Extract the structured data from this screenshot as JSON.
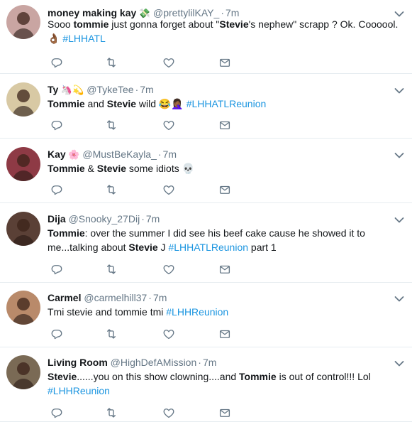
{
  "tweets": [
    {
      "name": "money making kay",
      "name_emoji": "💸",
      "handle": "@prettylilKAY_",
      "separator": "·",
      "time": "7m",
      "parts": [
        {
          "t": "Sooo "
        },
        {
          "t": "tommie",
          "b": true
        },
        {
          "t": " just gonna forget about \""
        },
        {
          "t": "Stevie",
          "b": true
        },
        {
          "t": "'s nephew\"  scrapp ? Ok. Coooool."
        }
      ],
      "line2": [
        {
          "t": "👌🏾 "
        },
        {
          "t": "#LHHATL",
          "tag": true
        }
      ],
      "avatar_color": "#c9a5a2"
    },
    {
      "name": "Ty",
      "name_emoji": "🦄💫",
      "handle": "@TykeTee",
      "separator": "·",
      "time": "7m",
      "parts": [
        {
          "t": "Tommie",
          "b": true
        },
        {
          "t": " and "
        },
        {
          "t": "Stevie",
          "b": true
        },
        {
          "t": " wild 😂🤦🏾‍♀️ "
        },
        {
          "t": "#LHHATLReunion",
          "tag": true
        }
      ],
      "line2": [],
      "avatar_color": "#d8c9a4"
    },
    {
      "name": "Kay",
      "name_emoji": "🌸",
      "handle": "@MustBeKayla_",
      "separator": "·",
      "time": "7m",
      "parts": [
        {
          "t": "Tommie",
          "b": true
        },
        {
          "t": " & "
        },
        {
          "t": "Stevie",
          "b": true
        },
        {
          "t": " some idiots 💀"
        }
      ],
      "line2": [],
      "avatar_color": "#8e3a45"
    },
    {
      "name": "Dija",
      "name_emoji": "",
      "handle": "@Snooky_27Dij",
      "separator": "·",
      "time": "7m",
      "parts": [
        {
          "t": "Tommie",
          "b": true
        },
        {
          "t": ": over the summer I did see his beef cake cause he showed it to"
        }
      ],
      "line2": [
        {
          "t": "me...talking about "
        },
        {
          "t": "Stevie",
          "b": true
        },
        {
          "t": " J "
        },
        {
          "t": "#LHHATLReunion",
          "tag": true
        },
        {
          "t": " part 1"
        }
      ],
      "avatar_color": "#5a4036"
    },
    {
      "name": "Carmel",
      "name_emoji": "",
      "handle": "@carmelhill37",
      "separator": "·",
      "time": "7m",
      "parts": [
        {
          "t": "Tmi stevie and tommie tmi "
        },
        {
          "t": "#LHHReunion",
          "tag": true
        }
      ],
      "line2": [],
      "avatar_color": "#b98a6a"
    },
    {
      "name": "Living Room",
      "name_emoji": "",
      "handle": "@HighDefAMission",
      "separator": "·",
      "time": "7m",
      "parts": [
        {
          "t": "Stevie",
          "b": true
        },
        {
          "t": "......you on this show clowning....and "
        },
        {
          "t": "Tommie",
          "b": true
        },
        {
          "t": " is out of control!!! Lol"
        }
      ],
      "line2": [
        {
          "t": "#LHHReunion",
          "tag": true
        }
      ],
      "avatar_color": "#7a6a55"
    }
  ],
  "icons": {
    "reply": "reply-icon",
    "retweet": "retweet-icon",
    "like": "heart-icon",
    "message": "envelope-icon",
    "menu": "chevron-down-icon"
  },
  "colors": {
    "text": "#14171a",
    "muted": "#657786",
    "link": "#1b95e0",
    "divider": "#e6ecf0"
  }
}
